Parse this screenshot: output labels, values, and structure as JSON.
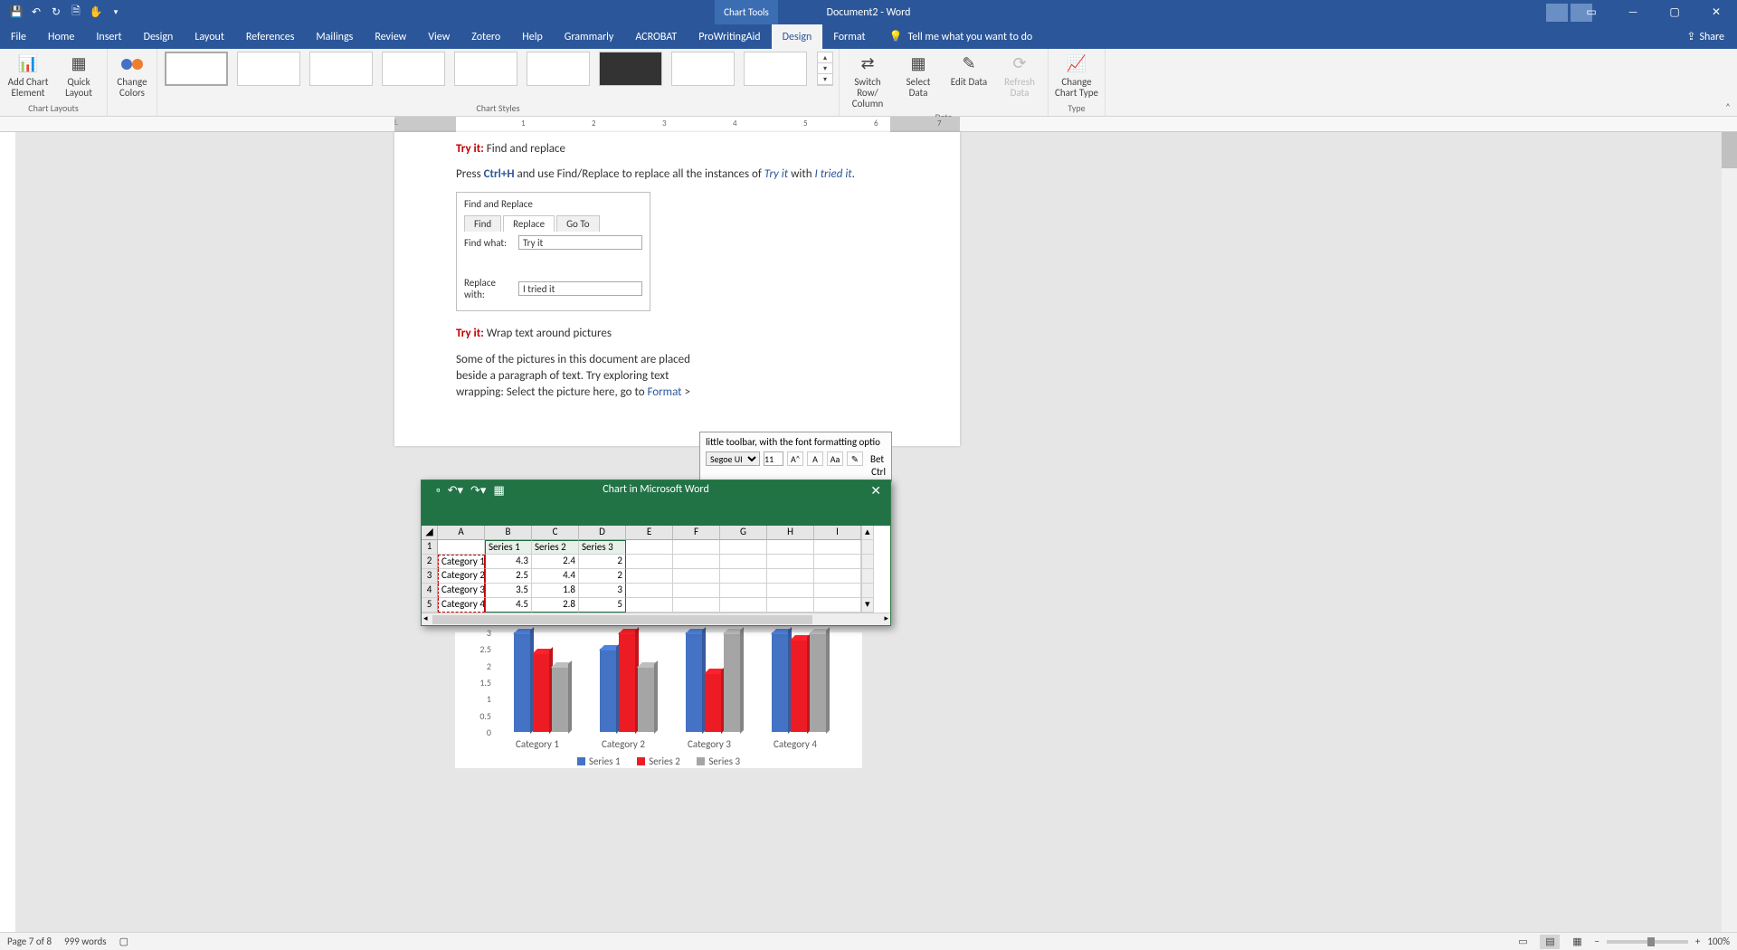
{
  "titlebar": {
    "doctitle": "Document2 - Word",
    "charttools": "Chart Tools"
  },
  "tabs": [
    "File",
    "Home",
    "Insert",
    "Design",
    "Layout",
    "References",
    "Mailings",
    "Review",
    "View",
    "Zotero",
    "Help",
    "Grammarly",
    "ACROBAT",
    "ProWritingAid",
    "Design",
    "Format"
  ],
  "active_tab_index": 14,
  "tellme": "Tell me what you want to do",
  "share": "Share",
  "ribbon": {
    "chartlayouts": {
      "label": "Chart Layouts",
      "addchart": "Add Chart Element",
      "quicklayout": "Quick Layout"
    },
    "colors": {
      "label": "Change Colors"
    },
    "styles_label": "Chart Styles",
    "data": {
      "label": "Data",
      "switchrow": "Switch Row/ Column",
      "select": "Select Data",
      "edit": "Edit Data",
      "refresh": "Refresh Data"
    },
    "type": {
      "label": "Type",
      "change": "Change Chart Type"
    }
  },
  "doc": {
    "tryit1": "Try it:",
    "tryit1b": " Find and replace",
    "p1a": "Press ",
    "p1b": "Ctrl+H",
    "p1c": " and use Find/Replace to replace all the instances of ",
    "p1d": "Try it",
    "p1e": " with ",
    "p1f": "I tried it",
    "p1g": ".",
    "fr": {
      "title": "Find and Replace",
      "tabs": [
        "Find",
        "Replace",
        "Go To"
      ],
      "findlabel": "Find what:",
      "findval": "Try it",
      "replabel": "Replace with:",
      "repval": "I tried it"
    },
    "tryit2": "Try it:",
    "tryit2b": " Wrap text around pictures",
    "p2": "Some of the pictures in this document are placed beside a paragraph of text. Try exploring text wrapping: Select the picture here, go to ",
    "p2fmt": "Format",
    "p2g": " >",
    "sidebox_ln1": "little toolbar, with the font formatting optio",
    "sb_font": "Segoe UI",
    "sb_size": "11",
    "sb_bet": "Bet",
    "sb_ctrl": "Ctrl"
  },
  "excel": {
    "title": "Chart in Microsoft Word",
    "cols": [
      "",
      "A",
      "B",
      "C",
      "D",
      "E",
      "F",
      "G",
      "H",
      "I"
    ],
    "rows": [
      {
        "n": "1",
        "c": [
          "",
          "Series 1",
          "Series 2",
          "Series 3",
          "",
          "",
          "",
          "",
          ""
        ]
      },
      {
        "n": "2",
        "c": [
          "Category 1",
          "4.3",
          "2.4",
          "2",
          "",
          "",
          "",
          "",
          ""
        ]
      },
      {
        "n": "3",
        "c": [
          "Category 2",
          "2.5",
          "4.4",
          "2",
          "",
          "",
          "",
          "",
          ""
        ]
      },
      {
        "n": "4",
        "c": [
          "Category 3",
          "3.5",
          "1.8",
          "3",
          "",
          "",
          "",
          "",
          ""
        ]
      },
      {
        "n": "5",
        "c": [
          "Category 4",
          "4.5",
          "2.8",
          "5",
          "",
          "",
          "",
          "",
          ""
        ]
      }
    ]
  },
  "chart_data": {
    "type": "bar",
    "categories": [
      "Category 1",
      "Category 2",
      "Category 3",
      "Category 4"
    ],
    "series": [
      {
        "name": "Series 1",
        "values": [
          4.3,
          2.5,
          3.5,
          4.5
        ],
        "color": "#4472c4"
      },
      {
        "name": "Series 2",
        "values": [
          2.4,
          4.4,
          1.8,
          2.8
        ],
        "color": "#ed1c24"
      },
      {
        "name": "Series 3",
        "values": [
          2,
          2,
          3,
          5
        ],
        "color": "#a5a5a5"
      }
    ],
    "yticks": [
      0,
      0.5,
      1,
      1.5,
      2,
      2.5,
      3
    ],
    "ylim": [
      0,
      3
    ]
  },
  "legend": {
    "s1": "Series 1",
    "s2": "Series 2",
    "s3": "Series 3"
  },
  "status": {
    "page": "Page 7 of 8",
    "words": "999 words",
    "zoom": "100%"
  }
}
